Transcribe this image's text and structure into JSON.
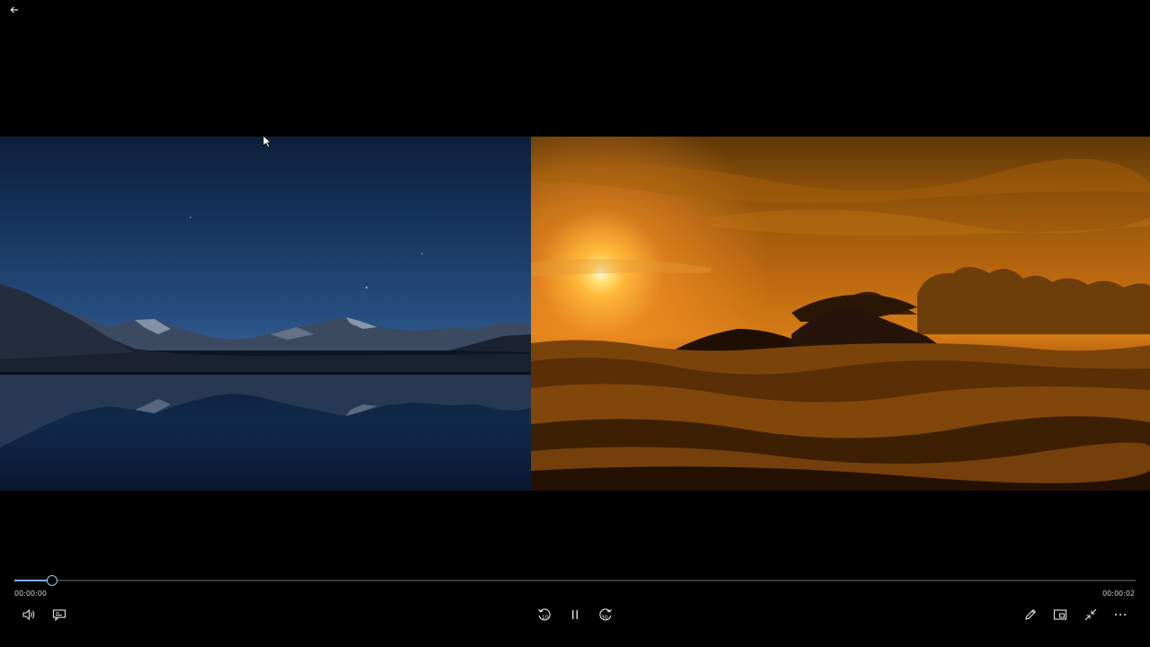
{
  "player": {
    "current_time": "00:00:00",
    "total_time": "00:00:02",
    "progress_percent": 3.4,
    "state": "playing"
  },
  "controls": {
    "skip_back_seconds": "10",
    "skip_forward_seconds": "30"
  },
  "icons": {
    "back": "back-arrow-icon",
    "volume": "volume-icon",
    "captions": "captions-icon",
    "skip_back": "skip-back-icon",
    "pause": "pause-icon",
    "skip_forward": "skip-forward-icon",
    "edit": "pencil-icon",
    "mini_view": "mini-view-icon",
    "fullscreen_exit": "exit-fullscreen-icon",
    "more": "more-icon"
  },
  "colors": {
    "accent": "#7eb3e8",
    "background": "#000000"
  }
}
